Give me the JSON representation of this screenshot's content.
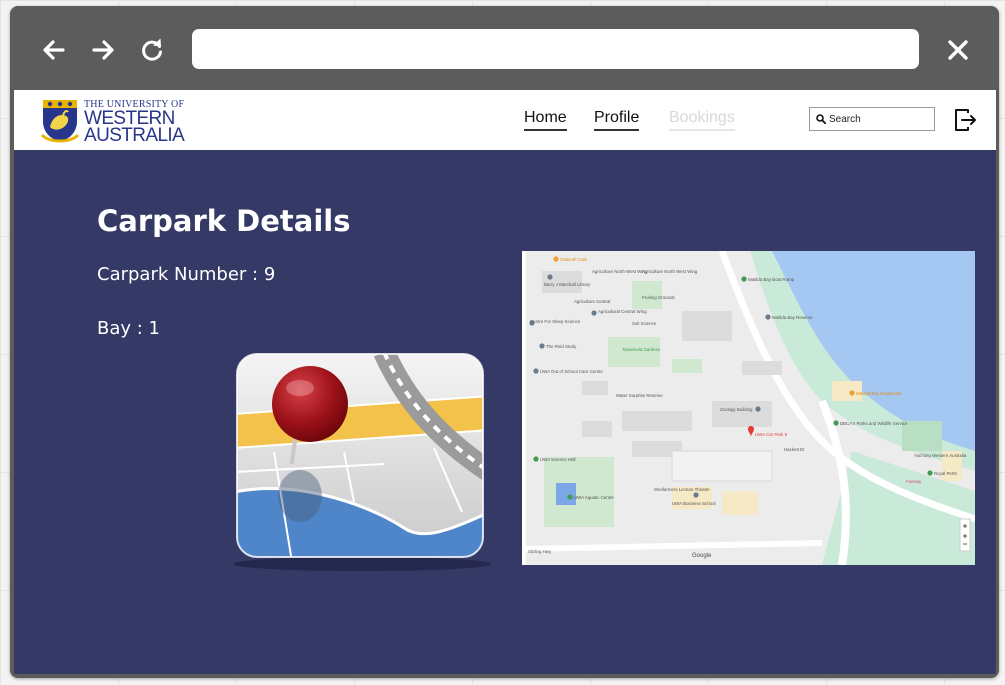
{
  "browser": {
    "back_icon": "arrow-left-icon",
    "forward_icon": "arrow-right-icon",
    "reload_icon": "reload-icon",
    "close_icon": "close-icon",
    "url_value": ""
  },
  "header": {
    "logo": {
      "line1": "THE UNIVERSITY OF",
      "line2": "WESTERN",
      "line3": "AUSTRALIA"
    },
    "nav": {
      "home": "Home",
      "profile": "Profile",
      "bookings": "Bookings"
    },
    "search": {
      "placeholder": "Search",
      "value": ""
    },
    "logout_icon": "logout-icon"
  },
  "main": {
    "title": "Carpark Details",
    "carpark_label": "Carpark Number : 9",
    "bay_label": "Bay : 1",
    "maps_icon": "maps-pin-icon"
  },
  "map": {
    "labels": {
      "cafe": "Oakcroft Cafe",
      "ag_south": "Agriculture North West Wing",
      "ag_north": "Agriculture North West Wing",
      "library": "Barry J Marshall Library",
      "ag_central": "Agriculture Central",
      "fruiting": "Fruiting Grounds",
      "agri_wing": "Agricultural Central Wing",
      "sleep": "Centre For Sleep Science",
      "soil": "Soil Science",
      "study": "The Reid Study",
      "gardens": "Tanaenola Gardens",
      "oosh": "UWA Out of School Care Centre",
      "visit": "Water Surprise Reserve",
      "zoology": "Zoology Building",
      "carpark": "UWA Car Park 9",
      "science_hall": "UWA Science Hall",
      "aquatic": "UWA Aquatic Centre",
      "theatre": "Wesfarmers Lecture Theatre",
      "business": "UWA Business School",
      "hackett": "Hackett Dr",
      "matilda_boat": "Matilda Bay Boat Ramp",
      "matilda_res": "Matilda Bay Reserve",
      "restaurant": "Matilda Bay Restaurant",
      "dbca": "DBCA's Parks and Wildlife Service",
      "royal_perth": "Royal Perth",
      "yacht": "Yachting Western Australia",
      "fairway": "Fairway",
      "google": "Google",
      "stirling": "Stirling Hwy"
    }
  }
}
